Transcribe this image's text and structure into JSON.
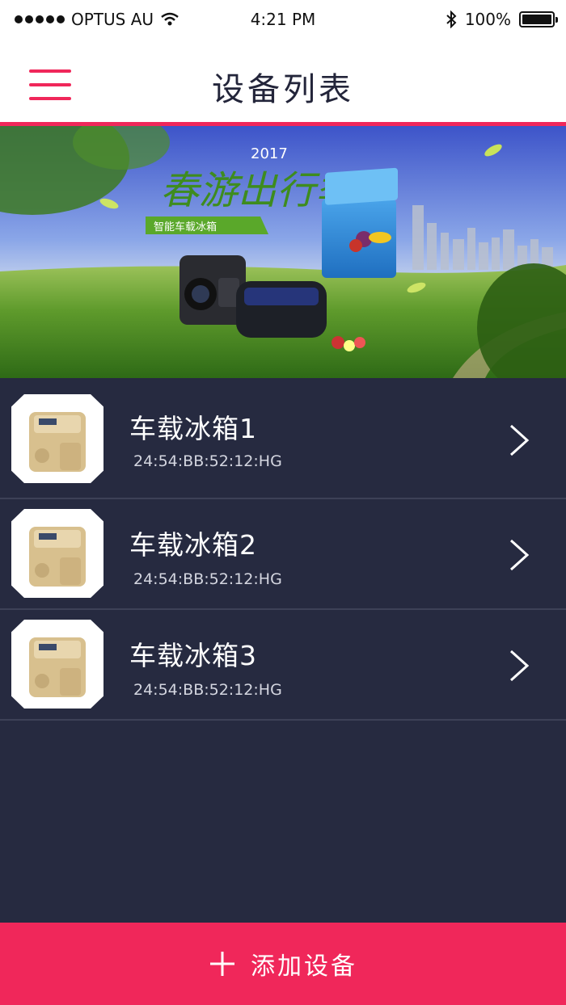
{
  "status_bar": {
    "carrier": "OPTUS AU",
    "time": "4:21 PM",
    "battery": "100%",
    "battery_level": 1.0,
    "icons": [
      "signal-dots-icon",
      "wifi-icon",
      "bluetooth-icon",
      "battery-icon"
    ]
  },
  "nav": {
    "title": "设备列表",
    "menu_icon": "hamburger-menu-icon"
  },
  "banner": {
    "headline": "春游出行季",
    "year": "2017",
    "tag": "智能车载冰箱"
  },
  "devices": [
    {
      "name": "车载冰箱1",
      "mac": "24:54:BB:52:12:HG"
    },
    {
      "name": "车载冰箱2",
      "mac": "24:54:BB:52:12:HG"
    },
    {
      "name": "车载冰箱3",
      "mac": "24:54:BB:52:12:HG"
    }
  ],
  "add_button": {
    "label": "添加设备",
    "icon": "plus-icon"
  },
  "colors": {
    "accent": "#f0275a",
    "background": "#262a40",
    "divider": "#3d4157",
    "text_primary": "#ffffff",
    "text_secondary": "#d4d6e0",
    "title_text": "#23253a"
  }
}
